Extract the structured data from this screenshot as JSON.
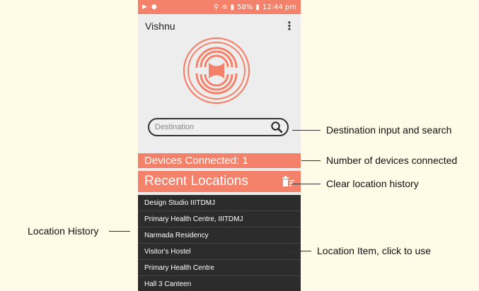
{
  "status_bar": {
    "battery": "58%",
    "time": "12:44 pm",
    "color": "#f4826a"
  },
  "app_bar": {
    "title": "Vishnu",
    "menu_glyph": "⋮"
  },
  "search": {
    "placeholder": "Destination"
  },
  "devices": {
    "label": "Devices Connected: 1"
  },
  "recent": {
    "title": "Recent Locations",
    "items": [
      "Design Studio IIITDMJ",
      "Primary Health Centre, IIITDMJ",
      "Narmada Residency",
      "Visitor's Hostel",
      "Primary Health Centre",
      "Hall 3 Canteen"
    ]
  },
  "annotations": {
    "destination": "Destination input and search",
    "devices": "Number of devices connected",
    "clear": "Clear location history",
    "history": "Location History",
    "item": "Location Item, click to use"
  },
  "colors": {
    "accent": "#f4826a",
    "list_bg": "#2c2c2c",
    "screen_bg": "#ededed"
  }
}
